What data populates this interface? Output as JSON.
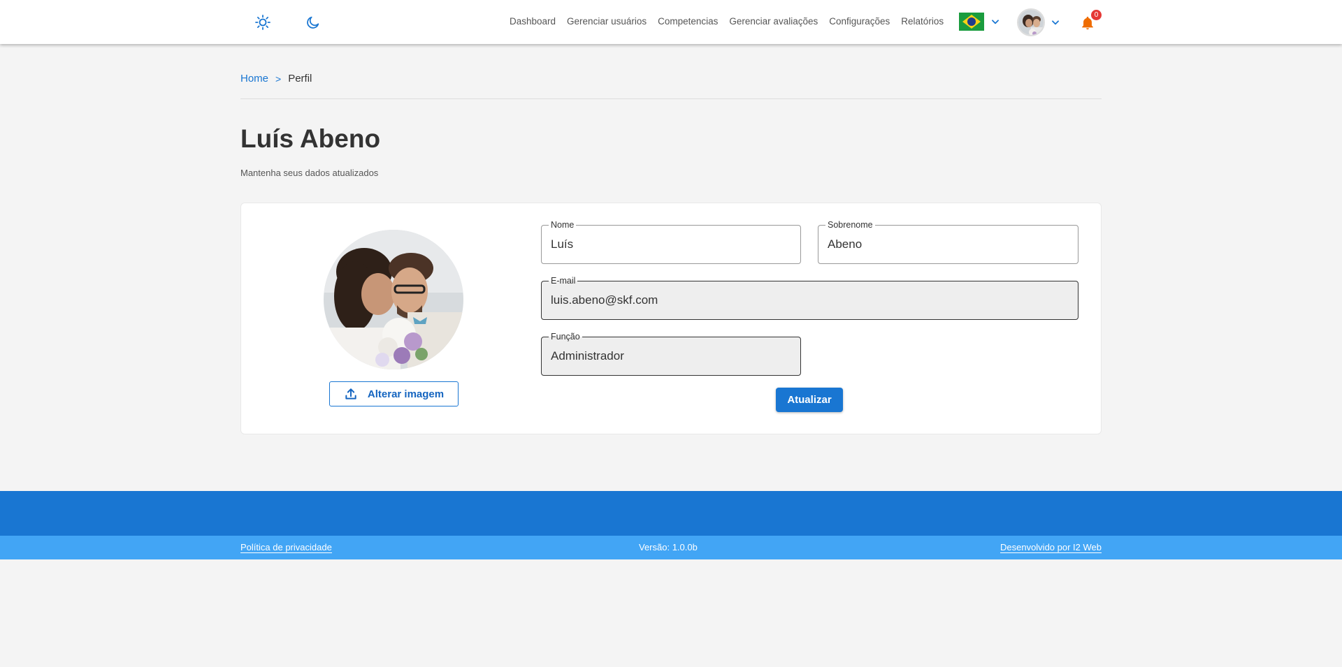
{
  "header": {
    "nav": [
      "Dashboard",
      "Gerenciar usuários",
      "Competencias",
      "Gerenciar avaliações",
      "Configurações",
      "Relatórios"
    ],
    "notification_count": "0",
    "accent_color": "#1976d2",
    "bell_color": "#ef6c00"
  },
  "breadcrumb": {
    "home": "Home",
    "separator": ">",
    "current": "Perfil"
  },
  "page": {
    "title": "Luís Abeno",
    "subtitle": "Mantenha seus dados atualizados"
  },
  "profile": {
    "change_image_label": "Alterar imagem"
  },
  "form": {
    "first_name": {
      "label": "Nome",
      "value": "Luís"
    },
    "last_name": {
      "label": "Sobrenome",
      "value": "Abeno"
    },
    "email": {
      "label": "E-mail",
      "value": "luis.abeno@skf.com"
    },
    "role": {
      "label": "Função",
      "value": "Administrador"
    },
    "submit_label": "Atualizar"
  },
  "footer": {
    "privacy": "Política de privacidade",
    "version": "Versão: 1.0.0b",
    "developer": "Desenvolvido por I2 Web"
  }
}
